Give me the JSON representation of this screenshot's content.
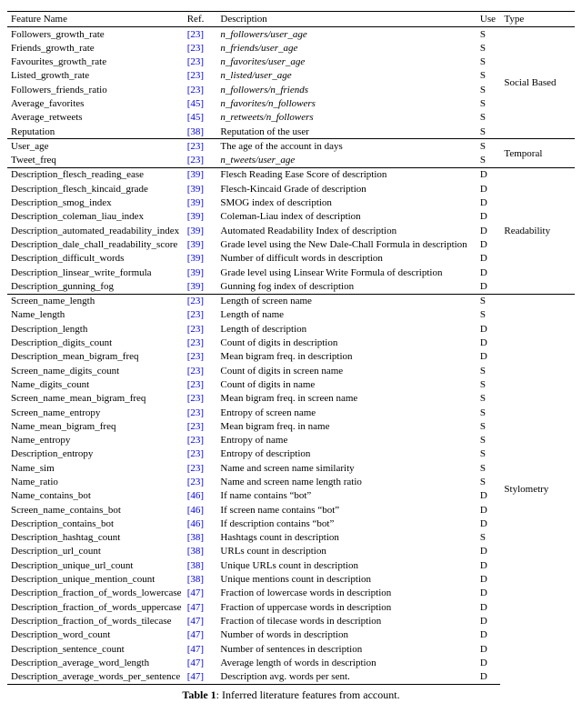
{
  "headers": {
    "feature": "Feature Name",
    "ref": "Ref.",
    "desc": "Description",
    "use": "Use",
    "type": "Type"
  },
  "groups": [
    {
      "type": "Social Based",
      "rows": [
        {
          "feature": "Followers_growth_rate",
          "ref": "23",
          "desc": "n_followers/user_age",
          "use": "S",
          "desc_italic": true
        },
        {
          "feature": "Friends_growth_rate",
          "ref": "23",
          "desc": "n_friends/user_age",
          "use": "S",
          "desc_italic": true
        },
        {
          "feature": "Favourites_growth_rate",
          "ref": "23",
          "desc": "n_favorites/user_age",
          "use": "S",
          "desc_italic": true
        },
        {
          "feature": "Listed_growth_rate",
          "ref": "23",
          "desc": "n_listed/user_age",
          "use": "S",
          "desc_italic": true
        },
        {
          "feature": "Followers_friends_ratio",
          "ref": "23",
          "desc": "n_followers/n_friends",
          "use": "S",
          "desc_italic": true
        },
        {
          "feature": "Average_favorites",
          "ref": "45",
          "desc": "n_favorites/n_followers",
          "use": "S",
          "desc_italic": true
        },
        {
          "feature": "Average_retweets",
          "ref": "45",
          "desc": "n_retweets/n_followers",
          "use": "S",
          "desc_italic": true
        },
        {
          "feature": "Reputation",
          "ref": "38",
          "desc": "Reputation of the user",
          "use": "S"
        }
      ]
    },
    {
      "type": "Temporal",
      "rows": [
        {
          "feature": "User_age",
          "ref": "23",
          "desc": "The age of the account in days",
          "use": "S"
        },
        {
          "feature": "Tweet_freq",
          "ref": "23",
          "desc": "n_tweets/user_age",
          "use": "S",
          "desc_italic": true
        }
      ]
    },
    {
      "type": "Readability",
      "rows": [
        {
          "feature": "Description_flesch_reading_ease",
          "ref": "39",
          "desc": "Flesch Reading Ease Score of description",
          "use": "D"
        },
        {
          "feature": "Description_flesch_kincaid_grade",
          "ref": "39",
          "desc": "Flesch-Kincaid Grade of description",
          "use": "D"
        },
        {
          "feature": "Description_smog_index",
          "ref": "39",
          "desc": "SMOG index of description",
          "use": "D"
        },
        {
          "feature": "Description_coleman_liau_index",
          "ref": "39",
          "desc": "Coleman-Liau index of description",
          "use": "D"
        },
        {
          "feature": "Description_automated_readability_index",
          "ref": "39",
          "desc": "Automated Readability Index of description",
          "use": "D"
        },
        {
          "feature": "Description_dale_chall_readability_score",
          "ref": "39",
          "desc": "Grade level using the New Dale-Chall Formula in description",
          "use": "D"
        },
        {
          "feature": "Description_difficult_words",
          "ref": "39",
          "desc": "Number of difficult words in description",
          "use": "D"
        },
        {
          "feature": "Description_linsear_write_formula",
          "ref": "39",
          "desc": "Grade level using Linsear Write Formula of description",
          "use": "D"
        },
        {
          "feature": "Description_gunning_fog",
          "ref": "39",
          "desc": "Gunning fog index of description",
          "use": "D"
        }
      ]
    },
    {
      "type": "Stylometry",
      "rows": [
        {
          "feature": "Screen_name_length",
          "ref": "23",
          "desc": "Length of screen name",
          "use": "S"
        },
        {
          "feature": "Name_length",
          "ref": "23",
          "desc": "Length of name",
          "use": "S"
        },
        {
          "feature": "Description_length",
          "ref": "23",
          "desc": "Length of description",
          "use": "D"
        },
        {
          "feature": "Description_digits_count",
          "ref": "23",
          "desc": "Count of digits in description",
          "use": "D"
        },
        {
          "feature": "Description_mean_bigram_freq",
          "ref": "23",
          "desc": "Mean bigram freq. in description",
          "use": "D"
        },
        {
          "feature": "Screen_name_digits_count",
          "ref": "23",
          "desc": "Count of digits in screen name",
          "use": "S"
        },
        {
          "feature": "Name_digits_count",
          "ref": "23",
          "desc": "Count of digits in name",
          "use": "S"
        },
        {
          "feature": "Screen_name_mean_bigram_freq",
          "ref": "23",
          "desc": "Mean bigram freq. in screen name",
          "use": "S"
        },
        {
          "feature": "Screen_name_entropy",
          "ref": "23",
          "desc": "Entropy of screen name",
          "use": "S"
        },
        {
          "feature": "Name_mean_bigram_freq",
          "ref": "23",
          "desc": "Mean bigram freq. in name",
          "use": "S"
        },
        {
          "feature": "Name_entropy",
          "ref": "23",
          "desc": "Entropy of name",
          "use": "S"
        },
        {
          "feature": "Description_entropy",
          "ref": "23",
          "desc": "Entropy of description",
          "use": "S"
        },
        {
          "feature": "Name_sim",
          "ref": "23",
          "desc": "Name and screen name similarity",
          "use": "S"
        },
        {
          "feature": "Name_ratio",
          "ref": "23",
          "desc": "Name and screen name length ratio",
          "use": "S"
        },
        {
          "feature": "Name_contains_bot",
          "ref": "46",
          "desc": "If name contains “bot”",
          "use": "D"
        },
        {
          "feature": "Screen_name_contains_bot",
          "ref": "46",
          "desc": "If screen name contains “bot”",
          "use": "D"
        },
        {
          "feature": "Description_contains_bot",
          "ref": "46",
          "desc": "If description contains “bot”",
          "use": "D"
        },
        {
          "feature": "Description_hashtag_count",
          "ref": "38",
          "desc": "Hashtags count in description",
          "use": "S"
        },
        {
          "feature": "Description_url_count",
          "ref": "38",
          "desc": "URLs count in description",
          "use": "D"
        },
        {
          "feature": "Description_unique_url_count",
          "ref": "38",
          "desc": "Unique URLs count in description",
          "use": "D"
        },
        {
          "feature": "Description_unique_mention_count",
          "ref": "38",
          "desc": "Unique mentions count in description",
          "use": "D"
        },
        {
          "feature": "Description_fraction_of_words_lowercase",
          "ref": "47",
          "desc": "Fraction of lowercase words in description",
          "use": "D"
        },
        {
          "feature": "Description_fraction_of_words_uppercase",
          "ref": "47",
          "desc": "Fraction of uppercase words in description",
          "use": "D"
        },
        {
          "feature": "Description_fraction_of_words_tilecase",
          "ref": "47",
          "desc": "Fraction of tilecase words in description",
          "use": "D"
        },
        {
          "feature": "Description_word_count",
          "ref": "47",
          "desc": "Number of words in description",
          "use": "D"
        },
        {
          "feature": "Description_sentence_count",
          "ref": "47",
          "desc": "Number of sentences in description",
          "use": "D"
        },
        {
          "feature": "Description_average_word_length",
          "ref": "47",
          "desc": "Average length of words in description",
          "use": "D"
        },
        {
          "feature": "Description_average_words_per_sentence",
          "ref": "47",
          "desc": "Description avg. words per sent.",
          "use": "D"
        }
      ]
    }
  ],
  "caption": {
    "label": "Table 1",
    "text": ": Inferred literature features from account."
  }
}
